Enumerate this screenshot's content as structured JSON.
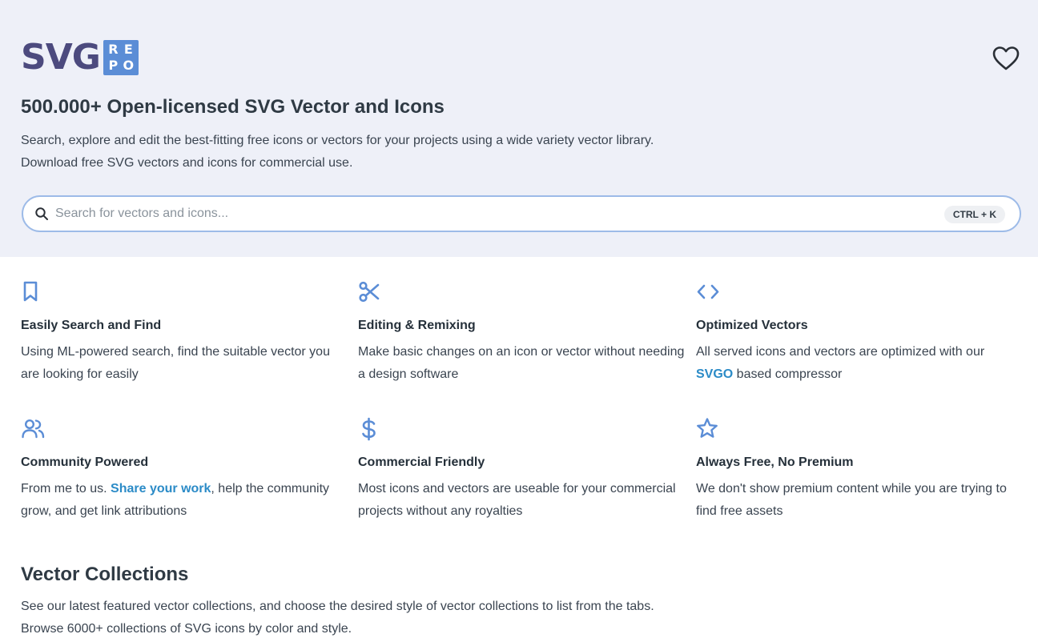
{
  "logo": {
    "main": "SVG",
    "badge": [
      "R",
      "E",
      "P",
      "O"
    ]
  },
  "hero": {
    "title": "500.000+ Open-licensed SVG Vector and Icons",
    "desc_line1": "Search, explore and edit the best-fitting free icons or vectors for your projects using a wide variety vector library.",
    "desc_line2": "Download free SVG vectors and icons for commercial use."
  },
  "search": {
    "placeholder": "Search for vectors and icons...",
    "value": "",
    "shortcut": "CTRL + K"
  },
  "features": [
    {
      "icon": "bookmark-icon",
      "title": "Easily Search and Find",
      "desc": "Using ML-powered search, find the suitable vector you are looking for easily"
    },
    {
      "icon": "scissors-icon",
      "title": "Editing & Remixing",
      "desc": "Make basic changes on an icon or vector without needing a design software"
    },
    {
      "icon": "code-icon",
      "title": "Optimized Vectors",
      "desc_before": "All served icons and vectors are optimized with our ",
      "link": "SVGO",
      "desc_after": " based compressor"
    },
    {
      "icon": "users-icon",
      "title": "Community Powered",
      "desc_before": "From me to us. ",
      "link": "Share your work",
      "desc_after": ", help the community grow, and get link attributions"
    },
    {
      "icon": "dollar-icon",
      "title": "Commercial Friendly",
      "desc": "Most icons and vectors are useable for your commercial projects without any royalties"
    },
    {
      "icon": "star-icon",
      "title": "Always Free, No Premium",
      "desc": "We don't show premium content while you are trying to find free assets"
    }
  ],
  "collections": {
    "title": "Vector Collections",
    "desc_line1": "See our latest featured vector collections, and choose the desired style of vector collections to list from the tabs.",
    "desc_line2": "Browse 6000+ collections of SVG icons by color and style."
  },
  "colors": {
    "hero_bg": "#eef0f8",
    "logo_text": "#4c4a7e",
    "logo_badge": "#5b8dd6",
    "icon_accent": "#5b8dd6",
    "link": "#2b8bc7",
    "search_border": "#9dbbe8"
  }
}
